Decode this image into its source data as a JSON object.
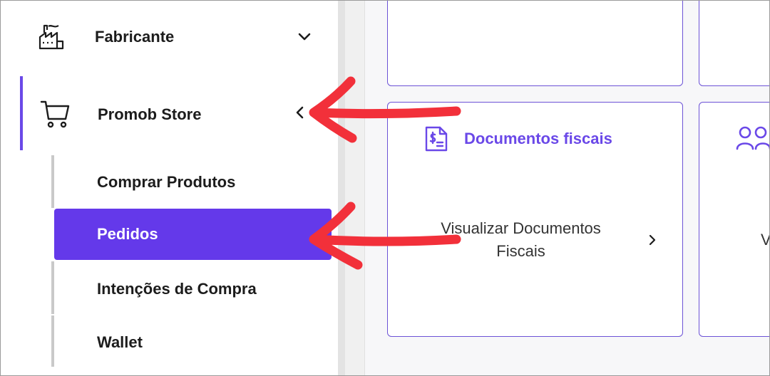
{
  "sidebar": {
    "fabricante": {
      "label": "Fabricante",
      "icon": "factory-icon",
      "chevron": "chevron-down-icon"
    },
    "promob_store": {
      "label": "Promob Store",
      "icon": "cart-icon",
      "chevron": "chevron-left-icon"
    },
    "submenu": [
      {
        "label": "Comprar Produtos",
        "active": false
      },
      {
        "label": "Pedidos",
        "active": true
      },
      {
        "label": "Intenções de Compra",
        "active": false
      },
      {
        "label": "Wallet",
        "active": false
      }
    ]
  },
  "main": {
    "cards": [
      {
        "title": "Documentos fiscais",
        "icon": "fiscal-document-icon",
        "body": "Visualizar Documentos Fiscais",
        "body_line1": "Visualizar Documentos",
        "body_line2": "Fiscais",
        "chevron": "chevron-right-icon"
      },
      {
        "title": "",
        "icon": "users-icon",
        "body": "V"
      }
    ]
  },
  "colors": {
    "accent": "#6a48e8",
    "active_bg": "#6439ea",
    "annotation_arrow": "#f2303a"
  }
}
